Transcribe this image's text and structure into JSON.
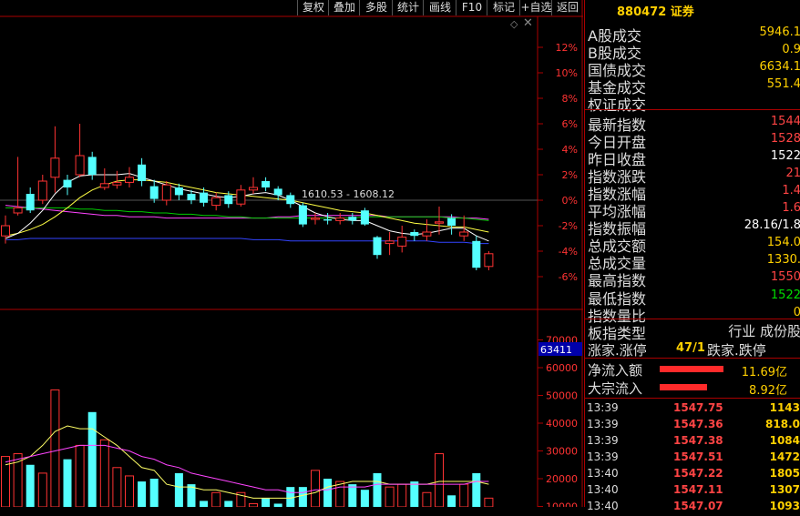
{
  "toolbar": {
    "buttons": [
      "复权",
      "叠加",
      "多股",
      "统计",
      "画线",
      "F10",
      "标记",
      "+自选",
      "返回"
    ]
  },
  "stock": {
    "code_name": "880472 证券"
  },
  "stats": [
    {
      "label": "A股成交",
      "value": "5946.1",
      "color": "#ffd000"
    },
    {
      "label": "B股成交",
      "value": "0.9",
      "color": "#ffd000"
    },
    {
      "label": "国债成交",
      "value": "6634.1",
      "color": "#ffd000"
    },
    {
      "label": "基金成交",
      "value": "551.4",
      "color": "#ffd000"
    },
    {
      "label": "权证成交",
      "value": "",
      "color": "#ffd000"
    },
    {
      "label": "最新指数",
      "value": "1544",
      "color": "#ff4444"
    },
    {
      "label": "今日开盘",
      "value": "1528",
      "color": "#ff4444"
    },
    {
      "label": "昨日收盘",
      "value": "1522",
      "color": "#ffffff"
    },
    {
      "label": "指数涨跌",
      "value": "21",
      "color": "#ff4444"
    },
    {
      "label": "指数涨幅",
      "value": "1.4",
      "color": "#ff4444"
    },
    {
      "label": "平均涨幅",
      "value": "1.6",
      "color": "#ff4444"
    },
    {
      "label": "指数振幅",
      "value": "28.16/1.8",
      "color": "#ffffff"
    },
    {
      "label": "总成交额",
      "value": "154.0",
      "color": "#ffd000"
    },
    {
      "label": "总成交量",
      "value": "1330.",
      "color": "#ffd000"
    },
    {
      "label": "最高指数",
      "value": "1550",
      "color": "#ff4444"
    },
    {
      "label": "最低指数",
      "value": "1522",
      "color": "#00dd00"
    },
    {
      "label": "指数量比",
      "value": "0",
      "color": "#ffd000"
    }
  ],
  "sector": {
    "label": "板指类型",
    "value": "行业 成份股"
  },
  "breadth": {
    "up_label": "涨家.涨停",
    "up_value": "47/1",
    "down_label": "跌家.跌停"
  },
  "flows": [
    {
      "label": "净流入额",
      "value": "11.69亿",
      "bar": 0.62
    },
    {
      "label": "大宗流入",
      "value": "8.92亿",
      "bar": 0.46
    }
  ],
  "ticks": [
    {
      "time": "13:39",
      "price": "1547.75",
      "vol": "1143"
    },
    {
      "time": "13:39",
      "price": "1547.36",
      "vol": "818.0"
    },
    {
      "time": "13:39",
      "price": "1547.38",
      "vol": "1084"
    },
    {
      "time": "13:39",
      "price": "1547.51",
      "vol": "1472"
    },
    {
      "time": "13:40",
      "price": "1547.22",
      "vol": "1805"
    },
    {
      "time": "13:40",
      "price": "1547.11",
      "vol": "1307"
    },
    {
      "time": "13:40",
      "price": "1547.07",
      "vol": "1093"
    }
  ],
  "price_axis": [
    "12%",
    "10%",
    "8%",
    "6%",
    "4%",
    "2%",
    "0%",
    "-2%",
    "-4%",
    "-6%"
  ],
  "volume_axis": [
    "70000",
    "60000",
    "50000",
    "40000",
    "30000",
    "20000",
    "10000"
  ],
  "volume_highlight": "63411",
  "annotation": "1610.53 - 1608.12",
  "chart_data": {
    "type": "candlestick",
    "ylim_pct": [
      -7,
      13
    ],
    "candles": [
      {
        "o": -2.8,
        "c": -2.0,
        "h": -1.2,
        "l": -3.4
      },
      {
        "o": -1.0,
        "c": -0.6,
        "h": 3.4,
        "l": -1.2
      },
      {
        "o": 0.5,
        "c": -0.8,
        "h": 1.0,
        "l": -1.0
      },
      {
        "o": 0.0,
        "c": 1.5,
        "h": 2.0,
        "l": -0.3
      },
      {
        "o": 1.8,
        "c": 3.3,
        "h": 5.8,
        "l": 0.6
      },
      {
        "o": 1.6,
        "c": 1.0,
        "h": 2.0,
        "l": 0.4
      },
      {
        "o": 2.0,
        "c": 3.5,
        "h": 6.0,
        "l": 1.8
      },
      {
        "o": 3.4,
        "c": 2.0,
        "h": 3.8,
        "l": 1.6
      },
      {
        "o": 1.0,
        "c": 1.3,
        "h": 2.5,
        "l": 0.8
      },
      {
        "o": 1.2,
        "c": 1.4,
        "h": 2.3,
        "l": 0.9
      },
      {
        "o": 1.4,
        "c": 1.8,
        "h": 2.6,
        "l": 1.0
      },
      {
        "o": 2.8,
        "c": 1.5,
        "h": 3.3,
        "l": 1.1
      },
      {
        "o": 1.1,
        "c": 0.1,
        "h": 1.6,
        "l": -0.2
      },
      {
        "o": 0.0,
        "c": 1.2,
        "h": 1.5,
        "l": -0.4
      },
      {
        "o": 1.0,
        "c": 0.4,
        "h": 1.3,
        "l": 0.0
      },
      {
        "o": 0.5,
        "c": 0.0,
        "h": 0.8,
        "l": -0.3
      },
      {
        "o": 0.6,
        "c": -0.2,
        "h": 1.0,
        "l": -0.5
      },
      {
        "o": -0.4,
        "c": 0.2,
        "h": 0.6,
        "l": -0.8
      },
      {
        "o": 0.4,
        "c": -0.3,
        "h": 0.7,
        "l": -0.6
      },
      {
        "o": -0.3,
        "c": 0.8,
        "h": 1.2,
        "l": -0.5
      },
      {
        "o": 0.8,
        "c": 1.0,
        "h": 1.8,
        "l": 0.5
      },
      {
        "o": 1.5,
        "c": 1.0,
        "h": 1.8,
        "l": 0.7
      },
      {
        "o": 0.9,
        "c": 0.4,
        "h": 1.1,
        "l": 0.0
      },
      {
        "o": 0.4,
        "c": -0.3,
        "h": 0.6,
        "l": -0.6
      },
      {
        "o": -0.4,
        "c": -1.9,
        "h": -0.2,
        "l": -2.1
      },
      {
        "o": -1.5,
        "c": -1.4,
        "h": -1.0,
        "l": -1.9
      },
      {
        "o": -1.5,
        "c": -1.6,
        "h": -1.0,
        "l": -1.9
      },
      {
        "o": -1.6,
        "c": -1.4,
        "h": -1.0,
        "l": -1.9
      },
      {
        "o": -1.3,
        "c": -1.6,
        "h": -1.0,
        "l": -1.9
      },
      {
        "o": -0.8,
        "c": -1.9,
        "h": -0.6,
        "l": -2.0
      },
      {
        "o": -2.9,
        "c": -4.3,
        "h": -2.8,
        "l": -4.6
      },
      {
        "o": -3.4,
        "c": -3.2,
        "h": -2.5,
        "l": -4.3
      },
      {
        "o": -3.6,
        "c": -2.9,
        "h": -2.0,
        "l": -4.1
      },
      {
        "o": -2.5,
        "c": -2.8,
        "h": -2.3,
        "l": -3.2
      },
      {
        "o": -2.8,
        "c": -2.5,
        "h": -1.5,
        "l": -3.2
      },
      {
        "o": -1.8,
        "c": -1.7,
        "h": -0.5,
        "l": -2.7
      },
      {
        "o": -1.4,
        "c": -2.0,
        "h": -1.1,
        "l": -2.7
      },
      {
        "o": -2.8,
        "c": -2.5,
        "h": -1.2,
        "l": -3.2
      },
      {
        "o": -3.2,
        "c": -5.3,
        "h": -2.8,
        "l": -5.5
      },
      {
        "o": -5.2,
        "c": -4.2,
        "h": -4.0,
        "l": -5.5
      }
    ],
    "ma5": [
      -3.0,
      -2.6,
      -1.8,
      -0.8,
      0.5,
      1.4,
      1.9,
      2.0,
      2.0,
      2.0,
      2.1,
      1.8,
      1.5,
      1.2,
      0.9,
      0.7,
      0.5,
      0.3,
      0.2,
      0.3,
      0.5,
      0.6,
      0.4,
      0.0,
      -0.5,
      -1.0,
      -1.3,
      -1.5,
      -1.6,
      -1.6,
      -2.0,
      -2.4,
      -2.6,
      -2.7,
      -2.6,
      -2.4,
      -2.2,
      -2.2,
      -2.8,
      -3.2
    ],
    "ma10": [
      -2.8,
      -2.6,
      -2.3,
      -1.9,
      -1.3,
      -0.6,
      0.2,
      0.8,
      1.2,
      1.5,
      1.6,
      1.6,
      1.5,
      1.4,
      1.2,
      1.0,
      0.8,
      0.6,
      0.5,
      0.4,
      0.3,
      0.2,
      0.1,
      0.0,
      -0.2,
      -0.4,
      -0.6,
      -0.8,
      -0.9,
      -1.0,
      -1.2,
      -1.4,
      -1.6,
      -1.8,
      -1.9,
      -2.0,
      -2.1,
      -2.1,
      -2.3,
      -2.5
    ],
    "ma20": [
      -0.6,
      -0.6,
      -0.6,
      -0.6,
      -0.6,
      -0.6,
      -0.7,
      -0.7,
      -0.8,
      -0.8,
      -0.9,
      -0.9,
      -1.0,
      -1.0,
      -1.1,
      -1.1,
      -1.2,
      -1.2,
      -1.3,
      -1.3,
      -1.4,
      -1.4,
      -1.4,
      -1.4,
      -1.4,
      -1.4,
      -1.4,
      -1.4,
      -1.4,
      -1.3,
      -1.3,
      -1.3,
      -1.3,
      -1.3,
      -1.3,
      -1.3,
      -1.4,
      -1.4,
      -1.5,
      -1.6
    ],
    "ma60": [
      -3.1,
      -3.1,
      -3.0,
      -3.0,
      -3.0,
      -3.0,
      -3.0,
      -3.0,
      -3.0,
      -3.0,
      -3.0,
      -3.0,
      -3.0,
      -3.0,
      -3.0,
      -3.0,
      -3.0,
      -3.0,
      -3.0,
      -3.0,
      -3.1,
      -3.1,
      -3.1,
      -3.2,
      -3.2,
      -3.2,
      -3.2,
      -3.2,
      -3.2,
      -3.2,
      -3.2,
      -3.2,
      -3.2,
      -3.2,
      -3.2,
      -3.3,
      -3.3,
      -3.3,
      -3.4,
      -3.4
    ],
    "ma_long": [
      -0.4,
      -0.5,
      -0.6,
      -0.7,
      -0.8,
      -0.9,
      -1.0,
      -1.1,
      -1.2,
      -1.2,
      -1.3,
      -1.3,
      -1.3,
      -1.4,
      -1.4,
      -1.4,
      -1.4,
      -1.4,
      -1.4,
      -1.4,
      -1.4,
      -1.4,
      -1.3,
      -1.3,
      -1.2,
      -1.2,
      -1.2,
      -1.2,
      -1.2,
      -1.2,
      -1.2,
      -1.3,
      -1.3,
      -1.3,
      -1.3,
      -1.3,
      -1.3,
      -1.4,
      -1.4,
      -1.5
    ],
    "volumes": [
      28000,
      29000,
      25000,
      22000,
      52000,
      27000,
      32000,
      44000,
      34000,
      24000,
      21000,
      19000,
      20000,
      9000,
      22000,
      18000,
      12000,
      15000,
      12000,
      15000,
      11000,
      13000,
      11000,
      17000,
      17000,
      23000,
      20000,
      19000,
      18000,
      16000,
      22000,
      17000,
      18000,
      19000,
      15000,
      29000,
      14000,
      18000,
      22000,
      13000
    ],
    "vol_ma5": [
      25000,
      26000,
      28000,
      32000,
      37000,
      39000,
      38000,
      38000,
      35000,
      32000,
      28000,
      24000,
      23000,
      18000,
      17000,
      17000,
      16000,
      16000,
      15000,
      14000,
      13000,
      13000,
      13000,
      13000,
      14000,
      15000,
      17000,
      18000,
      19000,
      19000,
      19000,
      18000,
      18000,
      18000,
      18000,
      19000,
      19000,
      19000,
      19000,
      18000
    ],
    "vol_ma10": [
      26000,
      27000,
      28000,
      29000,
      30000,
      31000,
      32000,
      32000,
      32000,
      31000,
      30000,
      28000,
      27000,
      25000,
      24000,
      22000,
      21000,
      20000,
      19000,
      18000,
      17000,
      16000,
      16000,
      15000,
      15000,
      16000,
      16000,
      17000,
      17000,
      17000,
      18000,
      18000,
      18000,
      18000,
      18000,
      18000,
      18000,
      18000,
      19000,
      19000
    ]
  }
}
